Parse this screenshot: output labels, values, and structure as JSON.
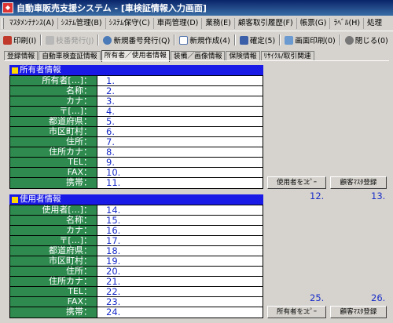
{
  "window": {
    "title": "自動車販売支援システム - [車検証情報入力画面]"
  },
  "menu": [
    "ﾏｽﾀﾒﾝﾃﾅﾝｽ(A)",
    "ｼｽﾃﾑ管理(B)",
    "ｼｽﾃﾑ保守(C)",
    "車両管理(D)",
    "業務(E)",
    "顧客取引履歴(F)",
    "帳票(G)",
    "ﾗﾍﾞﾙ(H)",
    "処理"
  ],
  "toolbar": {
    "print": "印刷(I)",
    "issue": "枝番発行(J)",
    "new_number": "新規番号発行(Q)",
    "new_create": "新規作成(4)",
    "confirm": "確定(5)",
    "screen_print": "画面印刷(0)",
    "close": "閉じる(0)"
  },
  "tabs": [
    "登録情報",
    "自動車検査証情報",
    "所有者／使用者情報",
    "装備／画像情報",
    "保険情報",
    "ﾘｻｲｸﾙ/取引関連"
  ],
  "owner": {
    "header": "所有者情報",
    "rows": [
      {
        "label": "所有者[…]：",
        "value": "1."
      },
      {
        "label": "名称：",
        "value": "2."
      },
      {
        "label": "カナ：",
        "value": "3."
      },
      {
        "label": "〒[…]：",
        "value": "4."
      },
      {
        "label": "都道府県：",
        "value": "5."
      },
      {
        "label": "市区町村：",
        "value": "6."
      },
      {
        "label": "住所：",
        "value": "7."
      },
      {
        "label": "住所カナ：",
        "value": "8."
      },
      {
        "label": "TEL：",
        "value": "9."
      },
      {
        "label": "FAX：",
        "value": "10."
      },
      {
        "label": "携帯：",
        "value": "11."
      }
    ],
    "copy_button": "使用者をｺﾋﾟｰ",
    "register_button": "顧客ﾏｽﾀ登録",
    "copy_num": "12.",
    "register_num": "13."
  },
  "user": {
    "header": "使用者情報",
    "rows": [
      {
        "label": "使用者[…]：",
        "value": "14."
      },
      {
        "label": "名称：",
        "value": "15."
      },
      {
        "label": "カナ：",
        "value": "16."
      },
      {
        "label": "〒[…]：",
        "value": "17."
      },
      {
        "label": "都道府県：",
        "value": "18."
      },
      {
        "label": "市区町村：",
        "value": "19."
      },
      {
        "label": "住所：",
        "value": "20."
      },
      {
        "label": "住所カナ：",
        "value": "21."
      },
      {
        "label": "TEL：",
        "value": "22."
      },
      {
        "label": "FAX：",
        "value": "23."
      },
      {
        "label": "携帯：",
        "value": "24."
      }
    ],
    "copy_button": "所有者をｺﾋﾟｰ",
    "register_button": "顧客ﾏｽﾀ登録",
    "copy_num": "25.",
    "register_num": "26."
  }
}
